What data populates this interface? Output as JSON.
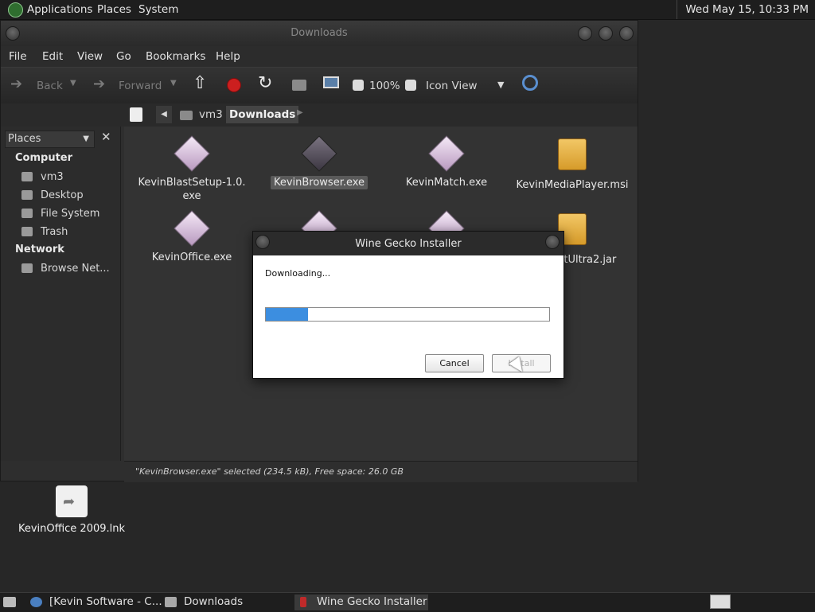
{
  "top_panel": {
    "menus": [
      "Applications",
      "Places",
      "System"
    ],
    "clock": "Wed May 15, 10:33 PM"
  },
  "file_manager": {
    "title": "Downloads",
    "menu": [
      "File",
      "Edit",
      "View",
      "Go",
      "Bookmarks",
      "Help"
    ],
    "toolbar": {
      "back": "Back",
      "forward": "Forward",
      "zoom": "100%",
      "view_mode": "Icon View"
    },
    "sidebar": {
      "selector": "Places",
      "sections": [
        {
          "title": "Computer",
          "items": [
            "vm3",
            "Desktop",
            "File System",
            "Trash"
          ]
        },
        {
          "title": "Network",
          "items": [
            "Browse Net..."
          ]
        }
      ]
    },
    "path": [
      "vm3",
      "Downloads"
    ],
    "files": [
      {
        "name": "KevinBlastSetup-1.0.\nexe",
        "icon": "package-gem-icon"
      },
      {
        "name": "KevinBrowser.exe",
        "icon": "package-gem-icon",
        "selected": true
      },
      {
        "name": "KevinMatch.exe",
        "icon": "package-gem-icon"
      },
      {
        "name": "KevinMediaPlayer.msi",
        "icon": "archive-box-icon"
      },
      {
        "name": "KevinOffice.exe",
        "icon": "package-gem-icon"
      },
      {
        "name": "astUltra2.jar",
        "icon": "archive-box-icon"
      }
    ],
    "status": "\"KevinBrowser.exe\" selected (234.5 kB), Free space: 26.0 GB"
  },
  "dialog": {
    "title": "Wine Gecko Installer",
    "message": "Downloading...",
    "progress": 0.15,
    "cancel": "Cancel",
    "install": "Install"
  },
  "desktop": {
    "icon_label": "KevinOffice 2009.lnk"
  },
  "taskbar": {
    "tasks": [
      "[Kevin Software - C...",
      "Downloads",
      "Wine Gecko Installer"
    ]
  },
  "colors": {
    "accent": "#3c8ee0",
    "record": "#cc1f1f"
  }
}
